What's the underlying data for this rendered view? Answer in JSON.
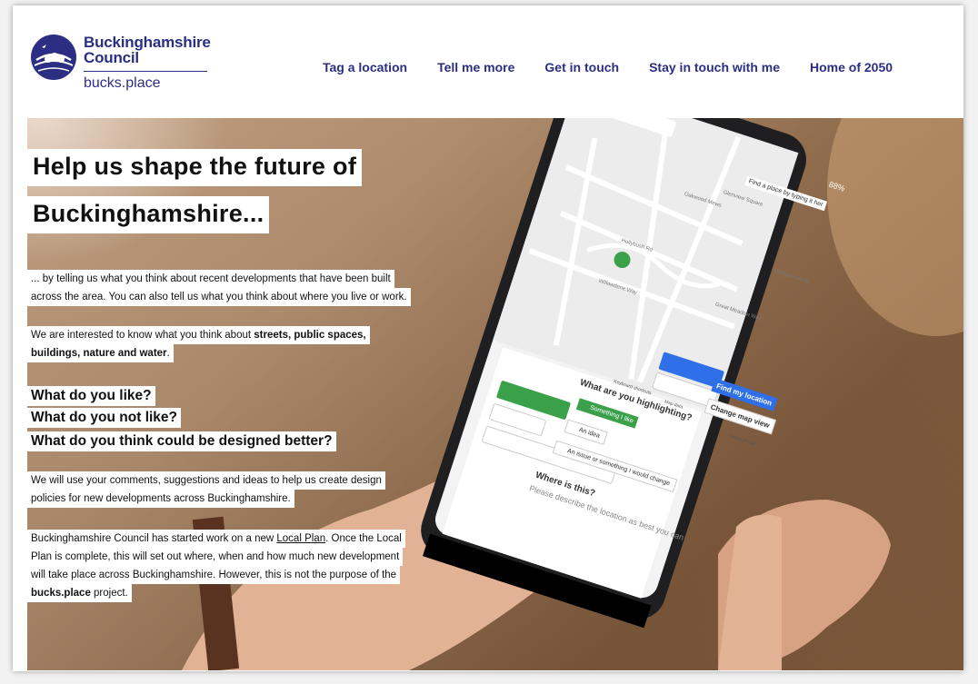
{
  "header": {
    "logo_name_line1": "Buckinghamshire",
    "logo_name_line2": "Council",
    "logo_site": "bucks.place"
  },
  "nav": {
    "items": [
      {
        "label": "Tag a location"
      },
      {
        "label": "Tell me more"
      },
      {
        "label": "Get in touch"
      },
      {
        "label": "Stay in touch with me"
      },
      {
        "label": "Home of 2050"
      }
    ]
  },
  "hero": {
    "title_line1": "Help us shape the future of",
    "title_line2": "Buckinghamshire...",
    "intro_line1": "... by telling us what you think about recent developments that have been built",
    "intro_line2": "across the area. You can also tell us what you think about where you live or work.",
    "interest_line1_prefix": "We are interested to know what you think about ",
    "interest_line1_bold": "streets, public spaces,",
    "interest_line2_bold": "buildings, nature and water",
    "interest_line2_suffix": ".",
    "question1": "What do you like?",
    "question2": "What do you not like?",
    "question3": "What do you think could be designed better?",
    "comments_line1": "We will use your comments, suggestions and ideas to help us create design",
    "comments_line2": "policies for new developments across Buckinghamshire.",
    "plan_line1_prefix": "Buckinghamshire Council has started work on a new ",
    "plan_line1_link": "Local Plan",
    "plan_line1_suffix": ". Once the Local",
    "plan_line2": "Plan is complete, this will set out where, when and how much new development",
    "plan_line3": "will take place across Buckinghamshire. However, this is not the purpose of the",
    "plan_line4_bold": "bucks.place",
    "plan_line4_suffix": " project."
  },
  "phone": {
    "status": "88%",
    "search_placeholder": "Find a place by typing it her",
    "find_location": "Find my location",
    "change_map": "Change map view",
    "keyboard_shortcuts": "Keyboard shortcuts",
    "map_data": "Map data",
    "terms": "Terms of Use",
    "highlight_question": "What are you highlighting?",
    "option1": "Something I like",
    "option2": "An idea",
    "option3": "An issue or something I would change",
    "where_title": "Where is this?",
    "where_hint": "Please describe the location as best you can",
    "street1": "Oakwood Mews",
    "street2": "Glenview Square",
    "street3": "Great Meadow Way",
    "street4": "Hollybush Rd",
    "street5": "Willowdene Way",
    "street6": "Wedgewood St"
  },
  "colors": {
    "brand": "#2b2e83",
    "accent_green": "#3aa14a",
    "accent_blue": "#2f6fe8"
  }
}
